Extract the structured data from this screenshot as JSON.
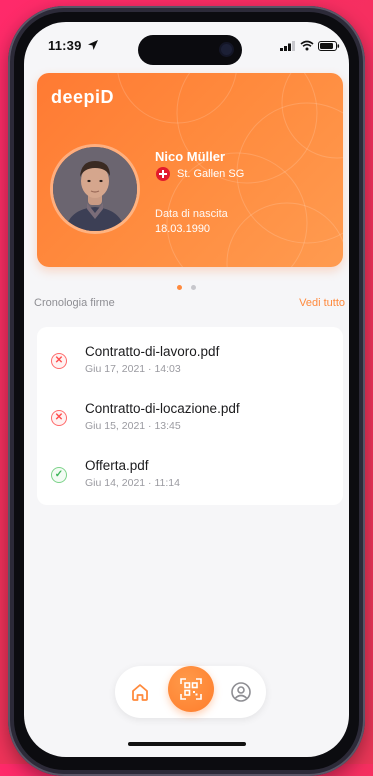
{
  "status_bar": {
    "time": "11:39"
  },
  "id_card": {
    "brand": "deepiD",
    "holder_name": "Nico Müller",
    "location": "St. Gallen SG",
    "dob_label": "Data di nascita",
    "dob_value": "18.03.1990"
  },
  "carousel": {
    "active_index": 0,
    "count": 2
  },
  "history": {
    "title": "Cronologia firme",
    "see_all": "Vedi tutto",
    "items": [
      {
        "name": "Contratto-di-lavoro.pdf",
        "date": "Giu 17, 2021 · 14:03",
        "status": "failed"
      },
      {
        "name": "Contratto-di-locazione.pdf",
        "date": "Giu 15, 2021 · 13:45",
        "status": "failed"
      },
      {
        "name": "Offerta.pdf",
        "date": "Giu 14, 2021 · 11:14",
        "status": "signed"
      }
    ]
  },
  "nav": {
    "items": [
      "home-icon",
      "qr-scan-icon",
      "profile-icon"
    ]
  },
  "colors": {
    "accent": "#ff8a3d",
    "background": "#f6f6f8",
    "failed": "#ff4f4f",
    "signed": "#3fb65a"
  }
}
